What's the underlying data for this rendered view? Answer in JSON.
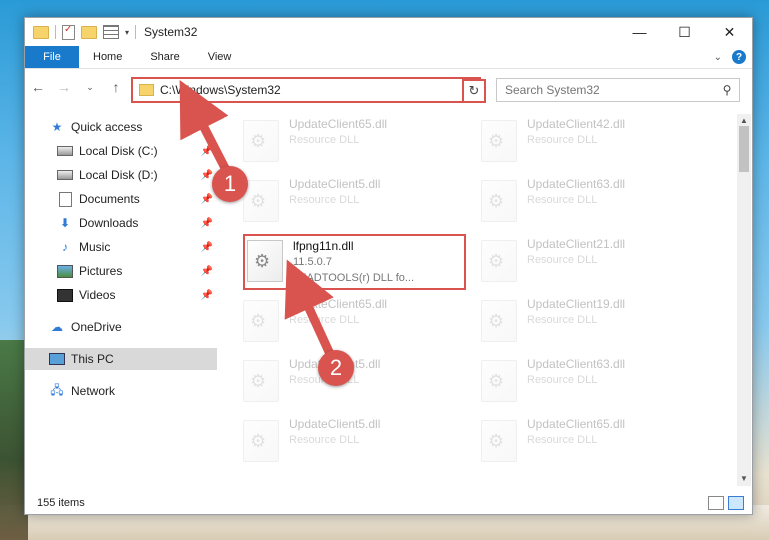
{
  "window": {
    "title": "System32"
  },
  "ribbon": {
    "file": "File",
    "home": "Home",
    "share": "Share",
    "view": "View",
    "help": "?"
  },
  "address": {
    "path": "C:\\Windows\\System32"
  },
  "search": {
    "placeholder": "Search System32"
  },
  "sidebar": {
    "items": [
      {
        "label": "Quick access",
        "icon": "star-icon",
        "pinned": false
      },
      {
        "label": "Local Disk (C:)",
        "icon": "drive-icon",
        "pinned": true
      },
      {
        "label": "Local Disk (D:)",
        "icon": "drive-icon",
        "pinned": true
      },
      {
        "label": "Documents",
        "icon": "documents-icon",
        "pinned": true
      },
      {
        "label": "Downloads",
        "icon": "download-icon",
        "pinned": true
      },
      {
        "label": "Music",
        "icon": "music-icon",
        "pinned": true
      },
      {
        "label": "Pictures",
        "icon": "pictures-icon",
        "pinned": true
      },
      {
        "label": "Videos",
        "icon": "videos-icon",
        "pinned": true
      },
      {
        "label": "OneDrive",
        "icon": "onedrive-icon",
        "pinned": false
      },
      {
        "label": "This PC",
        "icon": "pc-icon",
        "pinned": false,
        "selected": true
      },
      {
        "label": "Network",
        "icon": "network-icon",
        "pinned": false
      }
    ]
  },
  "files": {
    "col1": [
      {
        "name": "UpdateClient65.dll",
        "desc": "Resource DLL"
      },
      {
        "name": "UpdateClient5.dll",
        "desc": "Resource DLL"
      },
      {
        "name": "UpdateClient65.dll",
        "desc": "Resource DLL"
      },
      {
        "name": "UpdateClient5.dll",
        "desc": "Resource DLL"
      },
      {
        "name": "UpdateClient5.dll",
        "desc": "Resource DLL"
      }
    ],
    "col2": [
      {
        "name": "UpdateClient42.dll",
        "desc": "Resource DLL"
      },
      {
        "name": "UpdateClient63.dll",
        "desc": "Resource DLL"
      },
      {
        "name": "UpdateClient21.dll",
        "desc": "Resource DLL"
      },
      {
        "name": "UpdateClient19.dll",
        "desc": "Resource DLL"
      },
      {
        "name": "UpdateClient63.dll",
        "desc": "Resource DLL"
      },
      {
        "name": "UpdateClient65.dll",
        "desc": "Resource DLL"
      }
    ],
    "highlighted": {
      "name": "lfpng11n.dll",
      "version": "11.5.0.7",
      "desc": "LEADTOOLS(r) DLL fo..."
    }
  },
  "status": {
    "count": "155 items"
  },
  "annotations": {
    "badge1": "1",
    "badge2": "2"
  },
  "colors": {
    "accent": "#1979ca",
    "annotation": "#d9534f",
    "selection": "#d9d9d9"
  }
}
